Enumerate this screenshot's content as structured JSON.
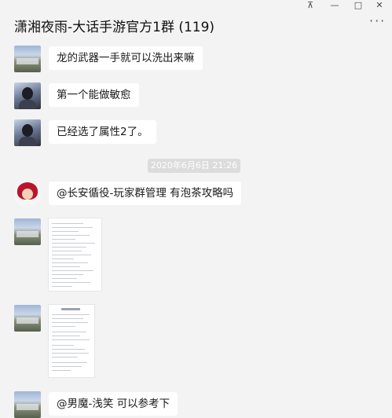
{
  "window": {
    "title": "潇湘夜雨-大话手游官方1群 (119)",
    "controls": {
      "pin": "⊼",
      "minimize": "—",
      "maximize": "□",
      "close": "✕"
    },
    "more": "···"
  },
  "messages": [
    {
      "type": "text",
      "avatar": "landscape-avatar",
      "text": "龙的武器一手就可以洗出来嘛"
    },
    {
      "type": "text",
      "avatar": "man-avatar",
      "text": "第一个能做敏愈"
    },
    {
      "type": "text",
      "avatar": "man-avatar",
      "text": "已经选了属性2了。"
    },
    {
      "type": "timestamp",
      "text": "2020年6月6日 21:26"
    },
    {
      "type": "text",
      "avatar": "girl-avatar",
      "text": "@长安循役-玩家群管理 有泡茶攻略吗"
    },
    {
      "type": "image",
      "avatar": "landscape-avatar",
      "image": "document-image"
    },
    {
      "type": "image",
      "avatar": "landscape-avatar",
      "image": "document-image"
    },
    {
      "type": "text",
      "avatar": "landscape-avatar",
      "text": "@男魔-浅笑 可以参考下"
    }
  ]
}
